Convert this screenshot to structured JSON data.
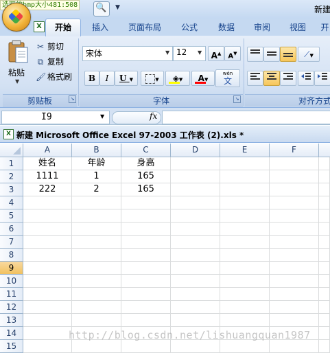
{
  "capture_label": "选取的bmp大小481:508",
  "window_title": "新建",
  "tabs": [
    "开始",
    "插入",
    "页面布局",
    "公式",
    "数据",
    "审阅",
    "视图",
    "开"
  ],
  "clipboard": {
    "paste": "粘贴",
    "cut": "剪切",
    "copy": "复制",
    "format_painter": "格式刷",
    "group_label": "剪贴板"
  },
  "font": {
    "name": "宋体",
    "size": "12",
    "grow": "A",
    "shrink": "A",
    "bold": "B",
    "italic": "I",
    "underline": "U",
    "font_color_letter": "A",
    "phonetic": "wén",
    "phonetic_char": "文",
    "group_label": "字体"
  },
  "alignment": {
    "group_label": "对齐方式"
  },
  "formula_bar": {
    "name_box": "I9",
    "fx": "fx",
    "formula": ""
  },
  "document_title": "新建 Microsoft Office Excel 97-2003 工作表 (2).xls *",
  "sheet": {
    "columns": [
      "A",
      "B",
      "C",
      "D",
      "E",
      "F"
    ],
    "rows": [
      "1",
      "2",
      "3",
      "4",
      "5",
      "6",
      "7",
      "8",
      "9",
      "10",
      "11",
      "12",
      "13",
      "14",
      "15"
    ],
    "selected_row": "9",
    "cells": [
      [
        "姓名",
        "年龄",
        "身高"
      ],
      [
        "1111",
        "1",
        "165"
      ],
      [
        "222",
        "2",
        "165"
      ]
    ]
  },
  "watermark": "http://blog.csdn.net/lishuangquan1987",
  "colors": {
    "ribbon_text": "#15428b",
    "ribbon_bg": "#d3e1f3",
    "selected_row_header": "#f1c15f",
    "font_color_swatch": "#ff0000",
    "highlight_swatch": "#ffff00"
  }
}
